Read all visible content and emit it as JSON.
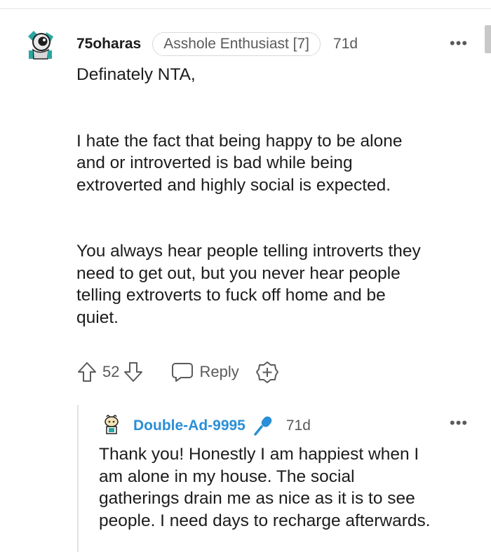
{
  "comment": {
    "username": "75oharas",
    "flair": "Asshole Enthusiast [7]",
    "timestamp": "71d",
    "paragraphs": [
      "Definately NTA,",
      "I hate the fact that being happy to be alone\nand or introverted is bad while being\nextroverted and highly social is expected.",
      "You always hear people telling introverts they\nneed to get out, but you never hear people\ntelling extroverts to fuck off home and be\nquiet."
    ],
    "votes": "52",
    "reply_label": "Reply",
    "more_label": "•••"
  },
  "reply": {
    "username": "Double-Ad-9995",
    "timestamp": "71d",
    "text": "Thank you! Honestly I am happiest when I\nam alone in my house. The social\ngatherings drain me as nice as it is to see\npeople. I need days to recharge afterwards.",
    "more_label": "•••",
    "username_color": "#2a8fd6"
  },
  "icons": {
    "upvote": "upvote-arrow-icon",
    "downvote": "downvote-arrow-icon",
    "reply": "speech-bubble-icon",
    "award": "award-plus-icon",
    "op_badge": "microphone-icon"
  }
}
